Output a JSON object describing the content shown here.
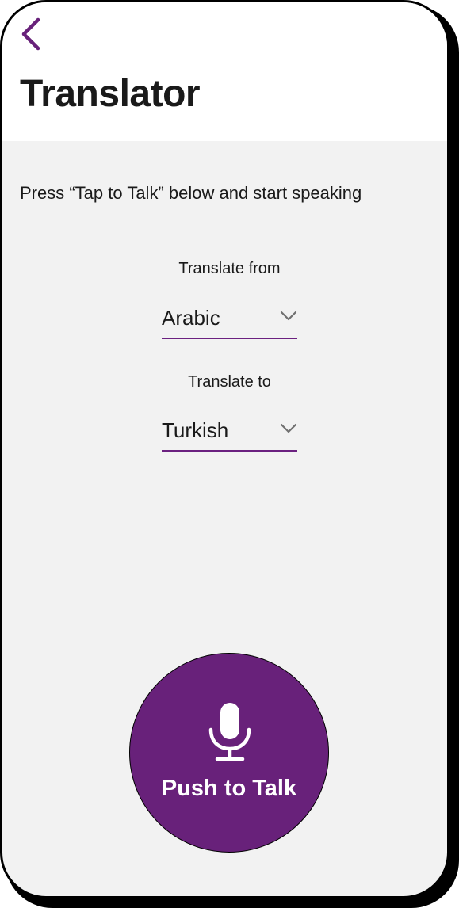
{
  "header": {
    "title": "Translator"
  },
  "main": {
    "instruction": "Press “Tap to Talk” below and start speaking",
    "from": {
      "label": "Translate from",
      "value": "Arabic"
    },
    "to": {
      "label": "Translate to",
      "value": "Turkish"
    },
    "talk_button": {
      "label": "Push to Talk"
    }
  },
  "icons": [
    "back-chevron-icon",
    "chevron-down-icon",
    "microphone-icon"
  ],
  "colors": {
    "accent": "#68217a",
    "background": "#f2f2f2",
    "header": "#ffffff",
    "text": "#1a1a1a"
  }
}
